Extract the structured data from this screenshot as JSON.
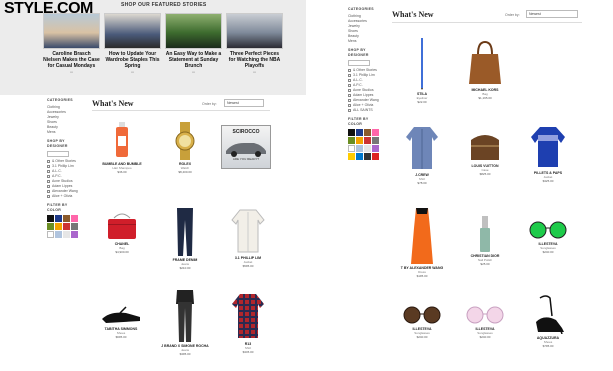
{
  "site": {
    "logo": "STYLE.COM"
  },
  "featured": {
    "heading": "SHOP OUR FEATURED STORIES",
    "cards": [
      {
        "title": "Caroline Brasch Nielsen Makes the Case for Casual Mondays"
      },
      {
        "title": "How to Update Your Wardrobe Staples This Spring"
      },
      {
        "title": "An Easy Way to Make a Statement at Sunday Brunch"
      },
      {
        "title": "Three Perfect Pieces for Watching the NBA Playoffs"
      }
    ]
  },
  "left": {
    "page_title": "What's New",
    "sort_label": "Order by:",
    "sort_value": "Newest",
    "categories": [
      "Clothing",
      "Accessories",
      "Jewelry",
      "Shoes",
      "Beauty",
      "Mens"
    ],
    "designers_heading": "SHOP BY DESIGNER",
    "designers": [
      "& Other Stories",
      "3.1 Phillip Lim",
      "A.L.C.",
      "A.P.C.",
      "Acne Studios",
      "Adam Lippes",
      "Alexander Wang",
      "Alice + Olivia"
    ],
    "color_heading": "FILTER BY COLOR",
    "colors": [
      "#111111",
      "#1e3a8a",
      "#8b5a2b",
      "#ff66aa",
      "#6b8e23",
      "#f4a300",
      "#cc3333",
      "#777777",
      "#ffffff",
      "#b0c4de",
      "#e6e6e6",
      "#aa66cc"
    ],
    "products": [
      {
        "name": "BUMBLE AND BUMBLE",
        "sub": "Hair Shampoo",
        "price": "$36.00"
      },
      {
        "name": "ROLEX",
        "sub": "Watch",
        "price": "$8,400.00"
      },
      {
        "name": "CHANEL",
        "sub": "Bag",
        "price": "$4,900.00"
      },
      {
        "name": "FRAME DENIM",
        "sub": "Jeans",
        "price": "$210.00"
      },
      {
        "name": "3.1 PHILLIP LIM",
        "sub": "Jacket",
        "price": "$595.00"
      },
      {
        "name": "TABITHA SIMMONS",
        "sub": "Shoes",
        "price": "$695.00"
      },
      {
        "name": "J BRAND X SIMONE ROCHA",
        "sub": "Jeans",
        "price": "$395.00"
      },
      {
        "name": "R13",
        "sub": "Shirt",
        "price": "$345.00"
      }
    ],
    "ad": {
      "brand": "SCIROCCO",
      "caption": "ARE YOU READY?"
    }
  },
  "right": {
    "page_title": "What's New",
    "sort_label": "Order by:",
    "sort_value": "Newest",
    "categories": [
      "Clothing",
      "Accessories",
      "Jewelry",
      "Shoes",
      "Beauty",
      "Mens"
    ],
    "designers_heading": "SHOP BY DESIGNER",
    "designers": [
      "& Other Stories",
      "3.1 Phillip Lim",
      "A.L.C.",
      "A.P.C.",
      "Acne Studios",
      "Adam Lippes",
      "Alexander Wang",
      "Alice + Olivia",
      "ALL SAINTS"
    ],
    "color_heading": "FILTER BY COLOR",
    "colors": [
      "#111111",
      "#1e3a8a",
      "#8b5a2b",
      "#ff66aa",
      "#6b8e23",
      "#f4a300",
      "#cc3333",
      "#777777",
      "#ffffff",
      "#b0c4de",
      "#e6e6e6",
      "#aa66cc",
      "#ffcc00",
      "#0077cc",
      "#333333",
      "#dd2222"
    ],
    "products": [
      {
        "name": "STILA",
        "sub": "Eyeliner",
        "price": "$22.00"
      },
      {
        "name": "MICHAEL KORS",
        "sub": "Bag",
        "price": "$1,195.00"
      },
      {
        "name": "J.CREW",
        "sub": "Shirt",
        "price": "$78.00"
      },
      {
        "name": "LOUIS VUITTON",
        "sub": "Case",
        "price": "$825.00"
      },
      {
        "name": "PILLETS & PAPS",
        "sub": "Jacket",
        "price": "$325.00"
      },
      {
        "name": "T BY ALEXANDER WANG",
        "sub": "Dress",
        "price": "$195.00"
      },
      {
        "name": "CHRISTIAN DIOR",
        "sub": "Nail Polish",
        "price": "$25.00"
      },
      {
        "name": "ILLESTEVA",
        "sub": "Sunglasses",
        "price": "$240.00"
      },
      {
        "name": "ILLESTEVA",
        "sub": "Sunglasses",
        "price": "$240.00"
      },
      {
        "name": "ILLESTEVA",
        "sub": "Sunglasses",
        "price": "$240.00"
      },
      {
        "name": "AQUAZZURA",
        "sub": "Shoes",
        "price": "$795.00"
      }
    ]
  }
}
